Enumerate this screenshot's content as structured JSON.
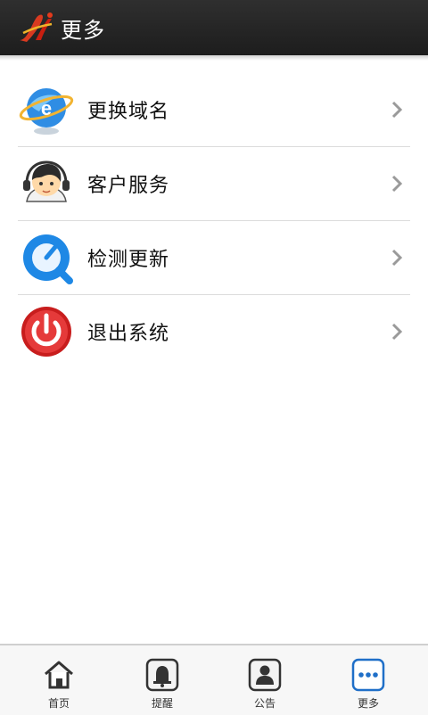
{
  "header": {
    "title": "更多",
    "logo_icon": "app-logo-icon"
  },
  "menu": {
    "items": [
      {
        "label": "更换域名",
        "icon": "globe-ie-icon"
      },
      {
        "label": "客户服务",
        "icon": "customer-service-icon"
      },
      {
        "label": "检测更新",
        "icon": "update-check-icon"
      },
      {
        "label": "退出系统",
        "icon": "power-icon"
      }
    ]
  },
  "tabbar": {
    "tabs": [
      {
        "label": "首页",
        "icon": "home-icon",
        "active": false
      },
      {
        "label": "提醒",
        "icon": "bell-icon",
        "active": false
      },
      {
        "label": "公告",
        "icon": "person-icon",
        "active": false
      },
      {
        "label": "更多",
        "icon": "more-icon",
        "active": true
      }
    ]
  },
  "colors": {
    "header_bg": "#232323",
    "accent": "#1f6fc8",
    "divider": "#dcdcdc"
  }
}
